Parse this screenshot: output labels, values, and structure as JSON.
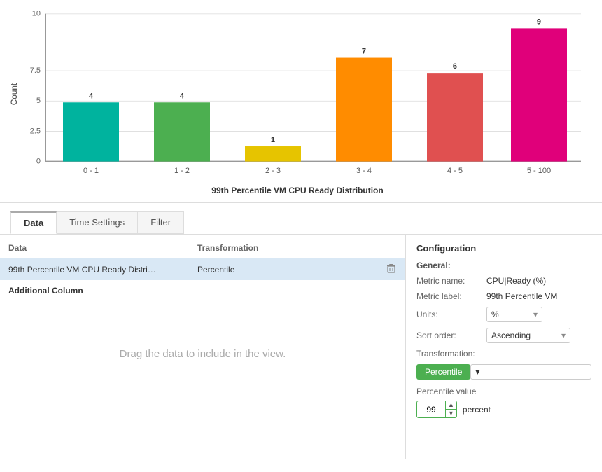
{
  "chart": {
    "title": "99th Percentile VM CPU Ready Distribution",
    "y_axis_label": "Count",
    "y_max": 10,
    "y_ticks": [
      0,
      2.5,
      5,
      7.5,
      10
    ],
    "bars": [
      {
        "label": "0 - 1",
        "value": 4,
        "color": "#00b39e",
        "height_pct": 40
      },
      {
        "label": "1 - 2",
        "value": 4,
        "color": "#4caf50",
        "height_pct": 40
      },
      {
        "label": "2 - 3",
        "value": 1,
        "color": "#e6c400",
        "height_pct": 10
      },
      {
        "label": "3 - 4",
        "value": 7,
        "color": "#ff8c00",
        "height_pct": 70
      },
      {
        "label": "4 - 5",
        "value": 6,
        "color": "#e05050",
        "height_pct": 60
      },
      {
        "label": "5 - 100",
        "value": 9,
        "color": "#e0007a",
        "height_pct": 90
      }
    ]
  },
  "tabs": [
    {
      "label": "Data",
      "active": true
    },
    {
      "label": "Time Settings",
      "active": false
    },
    {
      "label": "Filter",
      "active": false
    }
  ],
  "left_panel": {
    "col_data_header": "Data",
    "col_transform_header": "Transformation",
    "data_row": {
      "data_col": "99th Percentile VM CPU Ready Distri…",
      "transform_col": "Percentile"
    },
    "additional_column_label": "Additional Column",
    "drag_placeholder": "Drag the data to include in the view."
  },
  "right_panel": {
    "config_title": "Configuration",
    "general_label": "General:",
    "metric_name_label": "Metric name:",
    "metric_name_value": "CPU|Ready (%)",
    "metric_label_label": "Metric label:",
    "metric_label_value": "99th Percentile VM",
    "units_label": "Units:",
    "units_value": "%",
    "sort_order_label": "Sort order:",
    "sort_order_value": "Ascending",
    "transformation_label": "Transformation:",
    "transformation_btn_label": "Percentile",
    "percentile_value_label": "Percentile value",
    "percentile_value": "99",
    "percent_label": "percent"
  }
}
